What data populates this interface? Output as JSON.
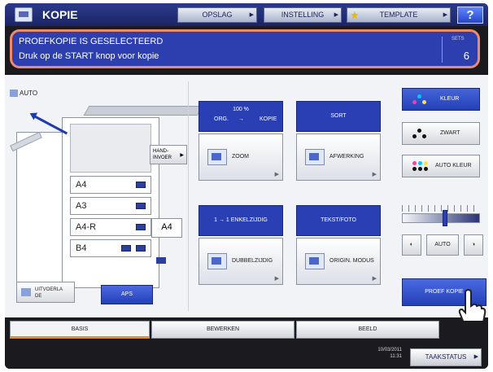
{
  "app": {
    "title": "KOPIE"
  },
  "topbar": {
    "opslag": "OPSLAG",
    "instelling": "INSTELLING",
    "template": "TEMPLATE",
    "help": "?"
  },
  "message": {
    "line1": "PROEFKOPIE IS GESELECTEERD",
    "line2": "Druk op de START knop voor kopie",
    "sets_label": "SETS",
    "sets_value": "6"
  },
  "paper": {
    "auto_label": "AUTO",
    "hand_invoer": "HAND-\nINVOER",
    "trays": [
      "A4",
      "A3",
      "A4-R",
      "B4"
    ],
    "bypass": "A4",
    "uitvoer": "UITVOERLA\nDE",
    "aps": "APS"
  },
  "functions": {
    "zoom": {
      "head_pct": "100 %",
      "head_org": "ORG.",
      "head_arrow": "→",
      "head_kopie": "KOPIE",
      "label": "ZOOM"
    },
    "afwerking": {
      "head": "SORT",
      "label": "AFWERKING"
    },
    "dubbelzijdig": {
      "head": "1 → 1 ENKELZIJDIG",
      "label": "DUBBELZIJDIG"
    },
    "origin_modus": {
      "head": "TEKST/FOTO",
      "label": "ORIGIN. MODUS"
    }
  },
  "color": {
    "kleur": "KLEUR",
    "zwart": "ZWART",
    "auto_kleur": "AUTO KLEUR",
    "accent": "#2440b8"
  },
  "density": {
    "auto": "AUTO",
    "level": 0.55
  },
  "proef": "PROEF KOPIE",
  "tabs": [
    "BASIS",
    "BEWERKEN",
    "BEELD"
  ],
  "status": {
    "date": "10/03/2011",
    "time": "11:31",
    "taakstatus": "TAAKSTATUS"
  }
}
